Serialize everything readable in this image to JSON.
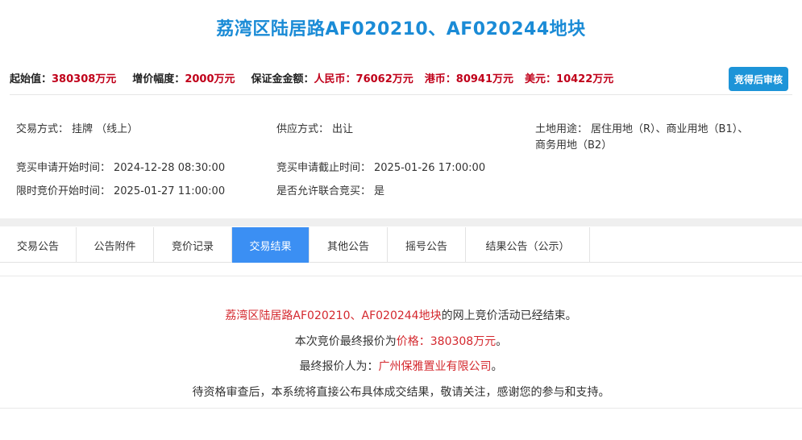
{
  "title": "荔湾区陆居路AF020210、AF020244地块",
  "pricebar": {
    "start_label": "起始值：",
    "start_value": "380308万元",
    "increment_label": "增价幅度：",
    "increment_value": "2000万元",
    "deposit_label": "保证金金额：",
    "rmb_label": "人民币：",
    "rmb_value": "76062万元",
    "hkd_label": "港币：",
    "hkd_value": "80941万元",
    "usd_label": "美元：",
    "usd_value": "10422万元",
    "audit_button": "竞得后审核"
  },
  "info": {
    "trade_mode_label": "交易方式：",
    "trade_mode_value": "挂牌 （线上）",
    "supply_label": "供应方式：",
    "supply_value": "出让",
    "use_label": "土地用途：",
    "use_value_line1": "居住用地（R）、商业用地（B1）、",
    "use_value_line2": "商务用地（B2）",
    "apply_start_label": "竞买申请开始时间：",
    "apply_start_value": "2024-12-28 08:30:00",
    "apply_end_label": "竞买申请截止时间：",
    "apply_end_value": "2025-01-26 17:00:00",
    "bid_start_label": "限时竞价开始时间：",
    "bid_start_value": "2025-01-27 11:00:00",
    "joint_label": "是否允许联合竞买：",
    "joint_value": "是"
  },
  "tabs": [
    {
      "label": "交易公告"
    },
    {
      "label": "公告附件"
    },
    {
      "label": "竞价记录"
    },
    {
      "label": "交易结果"
    },
    {
      "label": "其他公告"
    },
    {
      "label": "摇号公告"
    },
    {
      "label": "结果公告（公示）"
    }
  ],
  "result": {
    "line1_red": "荔湾区陆居路AF020210、AF020244地块",
    "line1_rest": "的网上竞价活动已经结束。",
    "line2_prefix": "本次竞价最终报价为",
    "line2_red": "价格：380308万元",
    "line2_suffix": "。",
    "line3_prefix": "最终报价人为：",
    "line3_red": "广州保雅置业有限公司",
    "line3_suffix": "。",
    "line4": "待资格审查后，本系统将直接公布具体成交结果，敬请关注，感谢您的参与和支持。"
  }
}
